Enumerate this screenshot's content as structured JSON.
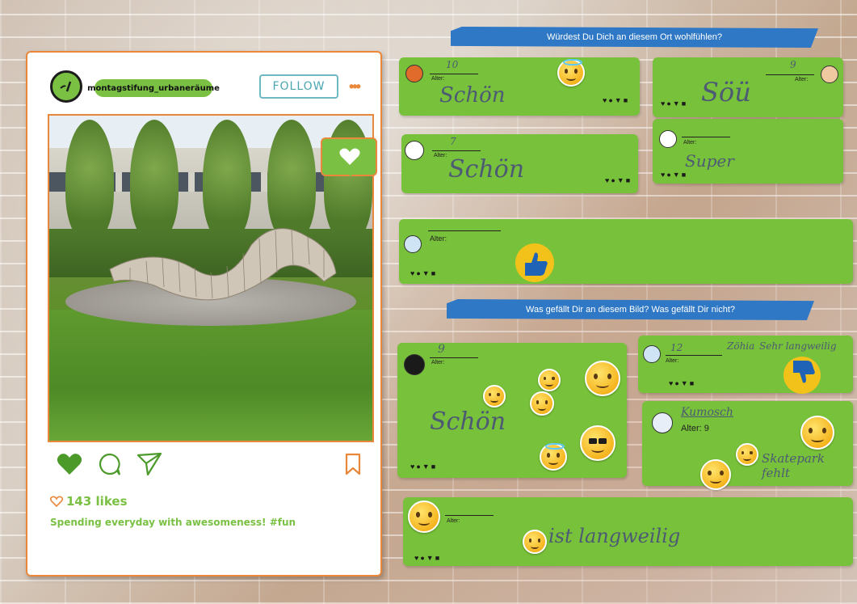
{
  "post": {
    "username": "montagstifung_urbaneräume",
    "follow_label": "FOLLOW",
    "more_label": "•••",
    "likes_count": "143 likes",
    "caption": "Spending everyday with awesomeness! #fun"
  },
  "banners": {
    "question1": "Würdest Du Dich an diesem Ort wohlfühlen?",
    "question2": "Was gefällt Dir an diesem Bild? Was gefällt Dir nicht?"
  },
  "comments": [
    {
      "alter_label": "Alter:",
      "age": "10",
      "text": "Schön"
    },
    {
      "alter_label": "Alter:",
      "age": "9",
      "text": "Söü"
    },
    {
      "alter_label": "Alter:",
      "age": "7",
      "text": "Schön"
    },
    {
      "alter_label": "Alter:",
      "age": "",
      "text": "Super"
    },
    {
      "alter_label": "Alter:",
      "age": "",
      "text": ""
    },
    {
      "alter_label": "Alter:",
      "age": "9",
      "text": "Schön"
    },
    {
      "alter_label": "Alter:",
      "age": "12",
      "name": "Zöhia",
      "text": "Sehr langweilig"
    },
    {
      "alter_label": "Alter: 9",
      "name": "Kumosch",
      "text": "Skatepark fehlt"
    },
    {
      "alter_label": "Alter:",
      "age": "",
      "text": "ist langweilig"
    }
  ],
  "icon_names": [
    "heart-icon",
    "comment-icon",
    "send-icon",
    "bookmark-icon"
  ],
  "colors": {
    "accent_green": "#78c13a",
    "accent_orange": "#e9873a",
    "banner_blue": "#2f78c5",
    "follow_teal": "#4aa6b3"
  }
}
